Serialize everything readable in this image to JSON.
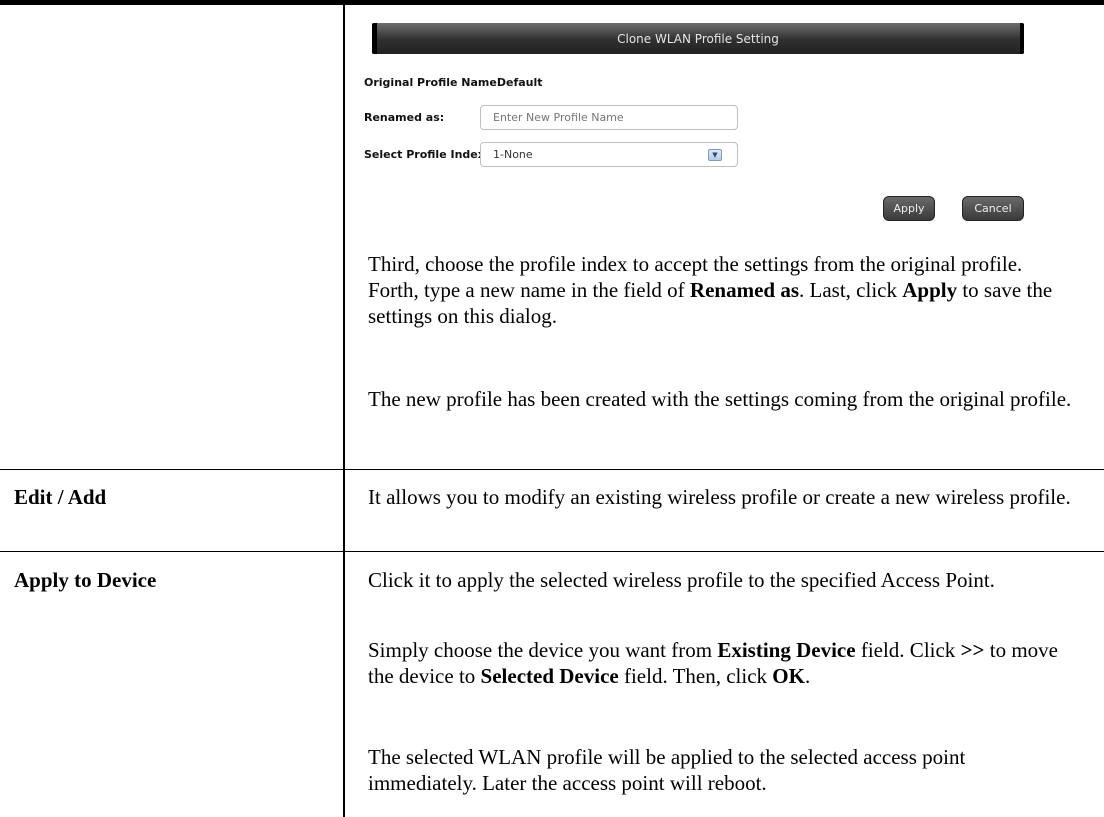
{
  "dialog": {
    "title": "Clone WLAN Profile Setting",
    "original_label": "Original Profile Name",
    "original_value": "Default",
    "renamed_label": "Renamed as:",
    "renamed_placeholder": "Enter New Profile Name",
    "index_label": "Select Profile Index",
    "index_value": "1-None",
    "apply_label": "Apply",
    "cancel_label": "Cancel"
  },
  "row1": {
    "p1_a": "Third, choose the profile index to accept the settings from the original profile. Forth, type a new name in the field of ",
    "p1_b1": "Renamed as",
    "p1_c": ". Last, click ",
    "p1_b2": "Apply",
    "p1_d": " to save the settings on this dialog.",
    "p2": "The new profile has been created with the settings coming from the original profile."
  },
  "row2": {
    "label": "Edit / Add",
    "text": "It allows you to modify an existing wireless profile or create a new wireless profile."
  },
  "row3": {
    "label": "Apply to Device",
    "p1": "Click it to apply the selected wireless profile to the specified Access Point.",
    "p2_a": "Simply choose the device you want from ",
    "p2_b1": "Existing Device",
    "p2_c": " field. Click ",
    "p2_b2": ">>",
    "p2_d": " to move the device to ",
    "p2_b3": "Selected Device",
    "p2_e": " field. Then, click ",
    "p2_b4": "OK",
    "p2_f": ".",
    "p3": "The selected WLAN profile will be applied to the selected access point immediately. Later the access point will reboot."
  }
}
